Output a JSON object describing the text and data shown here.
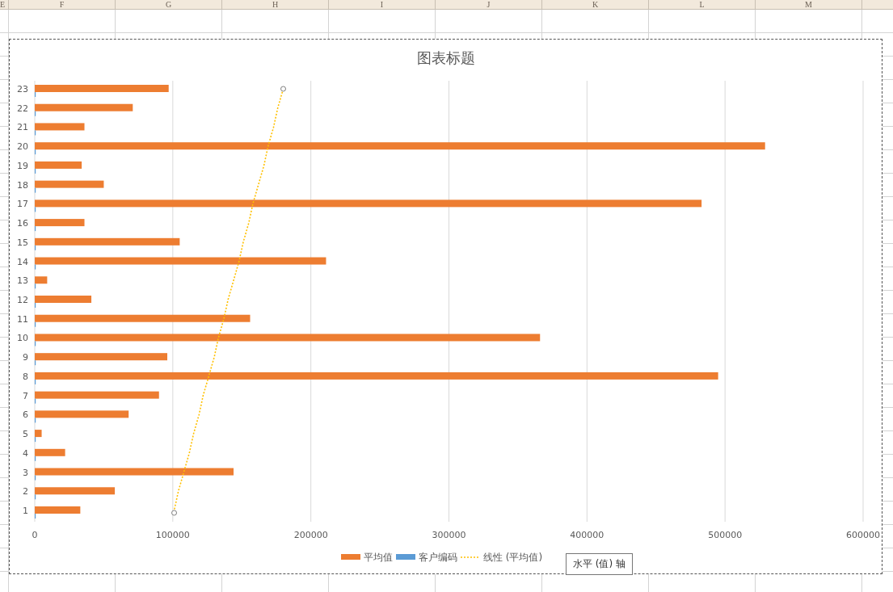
{
  "spreadsheet": {
    "column_headers": [
      "E",
      "F",
      "G",
      "H",
      "I",
      "J",
      "K",
      "L",
      "M"
    ]
  },
  "chart": {
    "chart_data": {
      "type": "bar",
      "orientation": "horizontal",
      "title": "图表标题",
      "categories": [
        "23",
        "22",
        "21",
        "20",
        "19",
        "18",
        "17",
        "16",
        "15",
        "14",
        "13",
        "12",
        "11",
        "10",
        "9",
        "8",
        "7",
        "6",
        "5",
        "4",
        "3",
        "2",
        "1"
      ],
      "xlim": [
        0,
        600000
      ],
      "xticks": [
        0,
        100000,
        200000,
        300000,
        400000,
        500000,
        600000
      ],
      "grid": true,
      "legend": true,
      "series": [
        {
          "name": "平均值",
          "type": "bar",
          "color": "#ed7d31",
          "values": [
            97000,
            71000,
            36000,
            529000,
            34000,
            50000,
            483000,
            36000,
            105000,
            211000,
            9000,
            41000,
            156000,
            366000,
            96000,
            495000,
            90000,
            68000,
            5000,
            22000,
            144000,
            58000,
            33000
          ]
        },
        {
          "name": "客户编码",
          "type": "bar",
          "color": "#5b9bd5",
          "values": [
            0,
            0,
            0,
            0,
            0,
            0,
            0,
            0,
            0,
            0,
            0,
            0,
            0,
            0,
            0,
            0,
            0,
            0,
            0,
            0,
            0,
            0,
            0
          ]
        },
        {
          "name": "线性 (平均值)",
          "type": "line",
          "line_style": "dotted",
          "color": "#ffc000",
          "values": [
            180000,
            176000,
            173000,
            169000,
            166000,
            162000,
            158000,
            155000,
            151000,
            148000,
            144000,
            140000,
            137000,
            133000,
            130000,
            126000,
            122000,
            119000,
            115000,
            112000,
            108000,
            104000,
            101000
          ]
        }
      ]
    }
  },
  "tooltip": "水平 (值) 轴"
}
